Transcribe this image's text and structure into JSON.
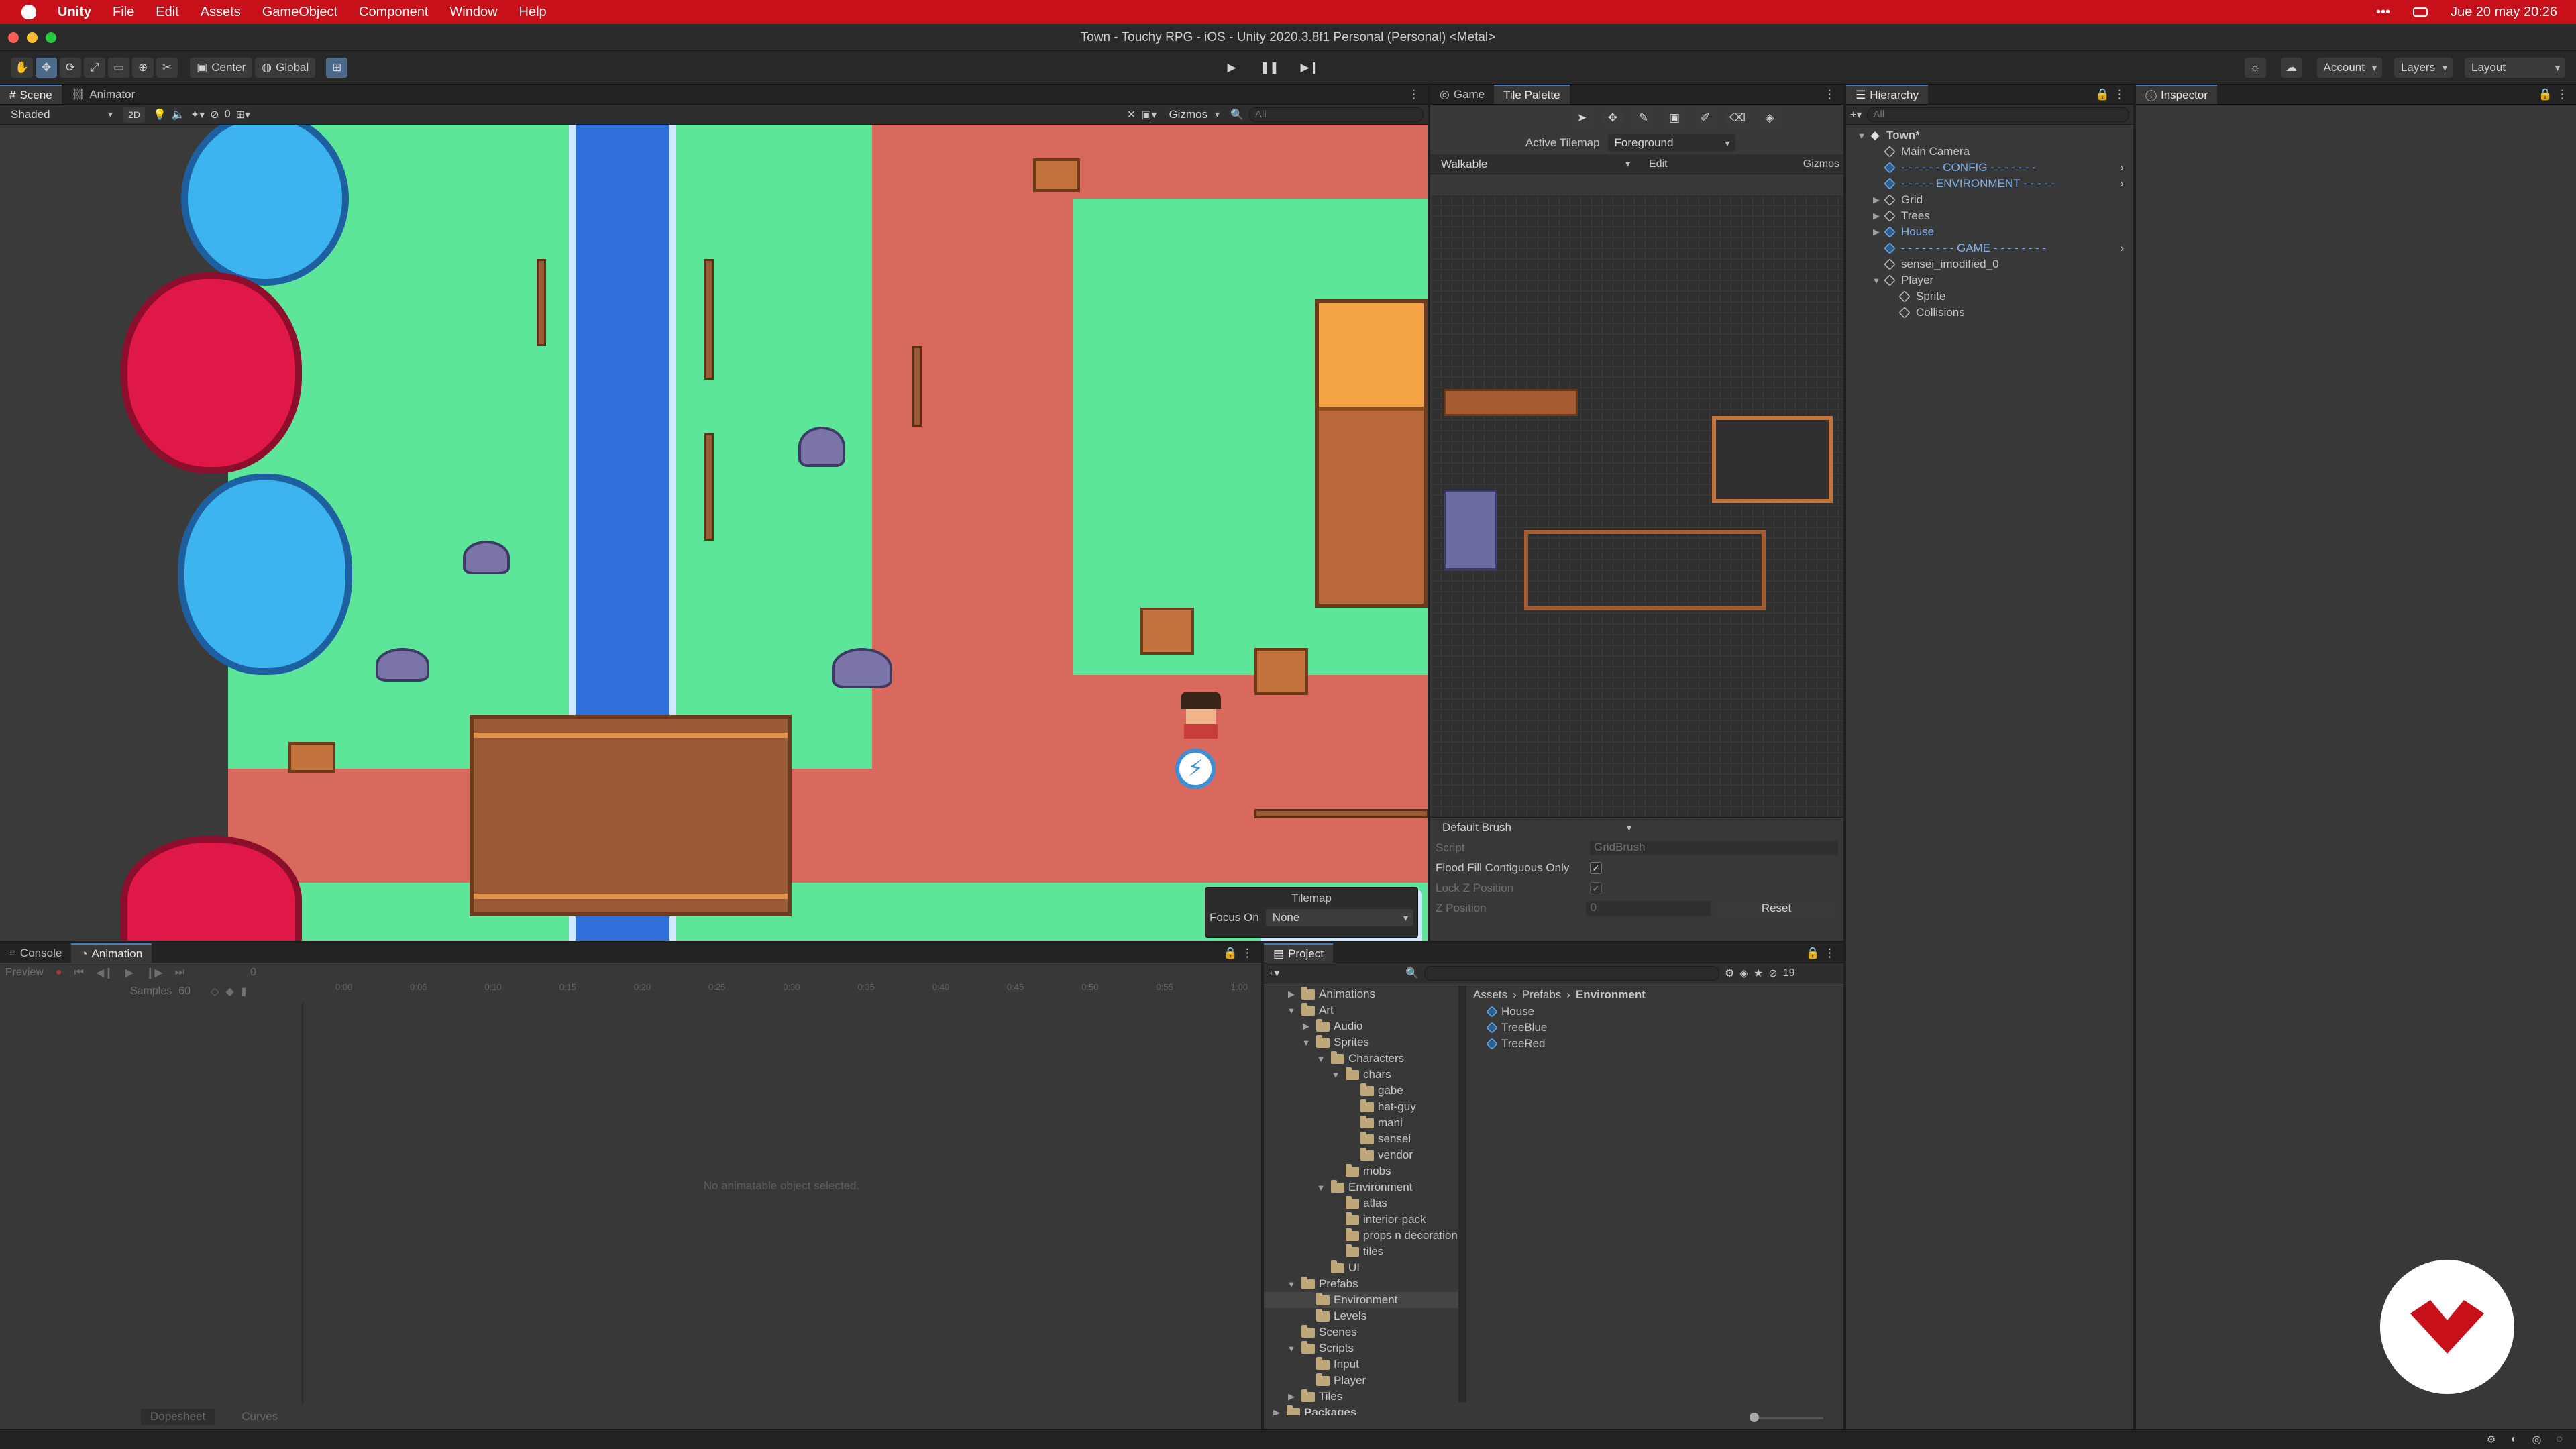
{
  "menubar": {
    "app": "Unity",
    "items": [
      "File",
      "Edit",
      "Assets",
      "GameObject",
      "Component",
      "Window",
      "Help"
    ],
    "datetime": "Jue 20 may  20:26"
  },
  "window": {
    "title": "Town - Touchy RPG - iOS - Unity 2020.3.8f1 Personal (Personal) <Metal>"
  },
  "toolbar": {
    "pivot": "Center",
    "space": "Global",
    "account": "Account",
    "layers": "Layers",
    "layout": "Layout"
  },
  "scene": {
    "tabs": [
      "Scene",
      "Animator"
    ],
    "shading": "Shaded",
    "mode2d": "2D",
    "gizmos": "Gizmos",
    "search_placeholder": "All",
    "layer_count": "0",
    "overlay": {
      "title": "Tilemap",
      "focus_label": "Focus On",
      "focus_value": "None"
    }
  },
  "game_panel": {
    "tabs": [
      "Game",
      "Tile Palette"
    ],
    "active_tilemap_label": "Active Tilemap",
    "active_tilemap_value": "Foreground",
    "palette": "Walkable",
    "edit": "Edit",
    "gizmos": "Gizmos",
    "brush": "Default Brush",
    "fields": [
      {
        "label": "Script",
        "value": "GridBrush",
        "dim": true,
        "type": "text"
      },
      {
        "label": "Flood Fill Contiguous Only",
        "value": "✓",
        "dim": false,
        "type": "check"
      },
      {
        "label": "Lock Z Position",
        "value": "✓",
        "dim": true,
        "type": "check"
      },
      {
        "label": "Z Position",
        "value": "0",
        "dim": true,
        "type": "text"
      }
    ],
    "reset": "Reset"
  },
  "hierarchy": {
    "title": "Hierarchy",
    "search_placeholder": "All",
    "items": [
      {
        "label": "Town*",
        "indent": 0,
        "arrow": "▼",
        "icon": "scene",
        "bold": true,
        "blue": false
      },
      {
        "label": "Main Camera",
        "indent": 1,
        "arrow": "",
        "icon": "cube",
        "bold": false,
        "blue": false
      },
      {
        "label": "- - - - - - CONFIG - - - - - - -",
        "indent": 1,
        "arrow": "",
        "icon": "prefab",
        "bold": false,
        "blue": true
      },
      {
        "label": "- - - - - ENVIRONMENT - - - - -",
        "indent": 1,
        "arrow": "",
        "icon": "prefab",
        "bold": false,
        "blue": true
      },
      {
        "label": "Grid",
        "indent": 1,
        "arrow": "▶",
        "icon": "cube",
        "bold": false,
        "blue": false
      },
      {
        "label": "Trees",
        "indent": 1,
        "arrow": "▶",
        "icon": "cube",
        "bold": false,
        "blue": false
      },
      {
        "label": "House",
        "indent": 1,
        "arrow": "▶",
        "icon": "prefab",
        "bold": false,
        "blue": true
      },
      {
        "label": "- - - - - - - - GAME - - - - - - - -",
        "indent": 1,
        "arrow": "",
        "icon": "prefab",
        "bold": false,
        "blue": true
      },
      {
        "label": "sensei_imodified_0",
        "indent": 1,
        "arrow": "",
        "icon": "cube",
        "bold": false,
        "blue": false
      },
      {
        "label": "Player",
        "indent": 1,
        "arrow": "▼",
        "icon": "cube",
        "bold": false,
        "blue": false
      },
      {
        "label": "Sprite",
        "indent": 2,
        "arrow": "",
        "icon": "cube",
        "bold": false,
        "blue": false
      },
      {
        "label": "Collisions",
        "indent": 2,
        "arrow": "",
        "icon": "cube",
        "bold": false,
        "blue": false
      }
    ]
  },
  "inspector": {
    "title": "Inspector"
  },
  "console": {
    "tabs": [
      "Console",
      "Animation"
    ],
    "preview": "Preview",
    "samples_label": "Samples",
    "samples_value": "60",
    "frame": "0",
    "timeline_marks": [
      "0:00",
      "0:05",
      "0:10",
      "0:15",
      "0:20",
      "0:25",
      "0:30",
      "0:35",
      "0:40",
      "0:45",
      "0:50",
      "0:55",
      "1:00"
    ],
    "empty_message": "No animatable object selected.",
    "dopesheet": "Dopesheet",
    "curves": "Curves"
  },
  "project": {
    "title": "Project",
    "hidden_count": "19",
    "breadcrumb": [
      "Assets",
      "Prefabs",
      "Environment"
    ],
    "tree": [
      {
        "label": "Animations",
        "indent": 1,
        "arrow": "▶",
        "selected": false
      },
      {
        "label": "Art",
        "indent": 1,
        "arrow": "▼",
        "selected": false
      },
      {
        "label": "Audio",
        "indent": 2,
        "arrow": "▶",
        "selected": false
      },
      {
        "label": "Sprites",
        "indent": 2,
        "arrow": "▼",
        "selected": false
      },
      {
        "label": "Characters",
        "indent": 3,
        "arrow": "▼",
        "selected": false
      },
      {
        "label": "chars",
        "indent": 4,
        "arrow": "▼",
        "selected": false
      },
      {
        "label": "gabe",
        "indent": 5,
        "arrow": "",
        "selected": false
      },
      {
        "label": "hat-guy",
        "indent": 5,
        "arrow": "",
        "selected": false
      },
      {
        "label": "mani",
        "indent": 5,
        "arrow": "",
        "selected": false
      },
      {
        "label": "sensei",
        "indent": 5,
        "arrow": "",
        "selected": false
      },
      {
        "label": "vendor",
        "indent": 5,
        "arrow": "",
        "selected": false
      },
      {
        "label": "mobs",
        "indent": 4,
        "arrow": "",
        "selected": false
      },
      {
        "label": "Environment",
        "indent": 3,
        "arrow": "▼",
        "selected": false
      },
      {
        "label": "atlas",
        "indent": 4,
        "arrow": "",
        "selected": false
      },
      {
        "label": "interior-pack",
        "indent": 4,
        "arrow": "",
        "selected": false
      },
      {
        "label": "props n decoration",
        "indent": 4,
        "arrow": "",
        "selected": false
      },
      {
        "label": "tiles",
        "indent": 4,
        "arrow": "",
        "selected": false
      },
      {
        "label": "UI",
        "indent": 3,
        "arrow": "",
        "selected": false
      },
      {
        "label": "Prefabs",
        "indent": 1,
        "arrow": "▼",
        "selected": false
      },
      {
        "label": "Environment",
        "indent": 2,
        "arrow": "",
        "selected": true
      },
      {
        "label": "Levels",
        "indent": 2,
        "arrow": "",
        "selected": false
      },
      {
        "label": "Scenes",
        "indent": 1,
        "arrow": "",
        "selected": false
      },
      {
        "label": "Scripts",
        "indent": 1,
        "arrow": "▼",
        "selected": false
      },
      {
        "label": "Input",
        "indent": 2,
        "arrow": "",
        "selected": false
      },
      {
        "label": "Player",
        "indent": 2,
        "arrow": "",
        "selected": false
      },
      {
        "label": "Tiles",
        "indent": 1,
        "arrow": "▶",
        "selected": false
      },
      {
        "label": "Packages",
        "indent": 0,
        "arrow": "▶",
        "selected": false
      }
    ],
    "assets": [
      "House",
      "TreeBlue",
      "TreeRed"
    ]
  },
  "colors": {
    "menubar": "#c8101a",
    "accent": "#4a7cbf",
    "grass": "#5de69a",
    "path": "#d9695d",
    "water": "#2f6fd9",
    "logo": "#c8101a"
  }
}
